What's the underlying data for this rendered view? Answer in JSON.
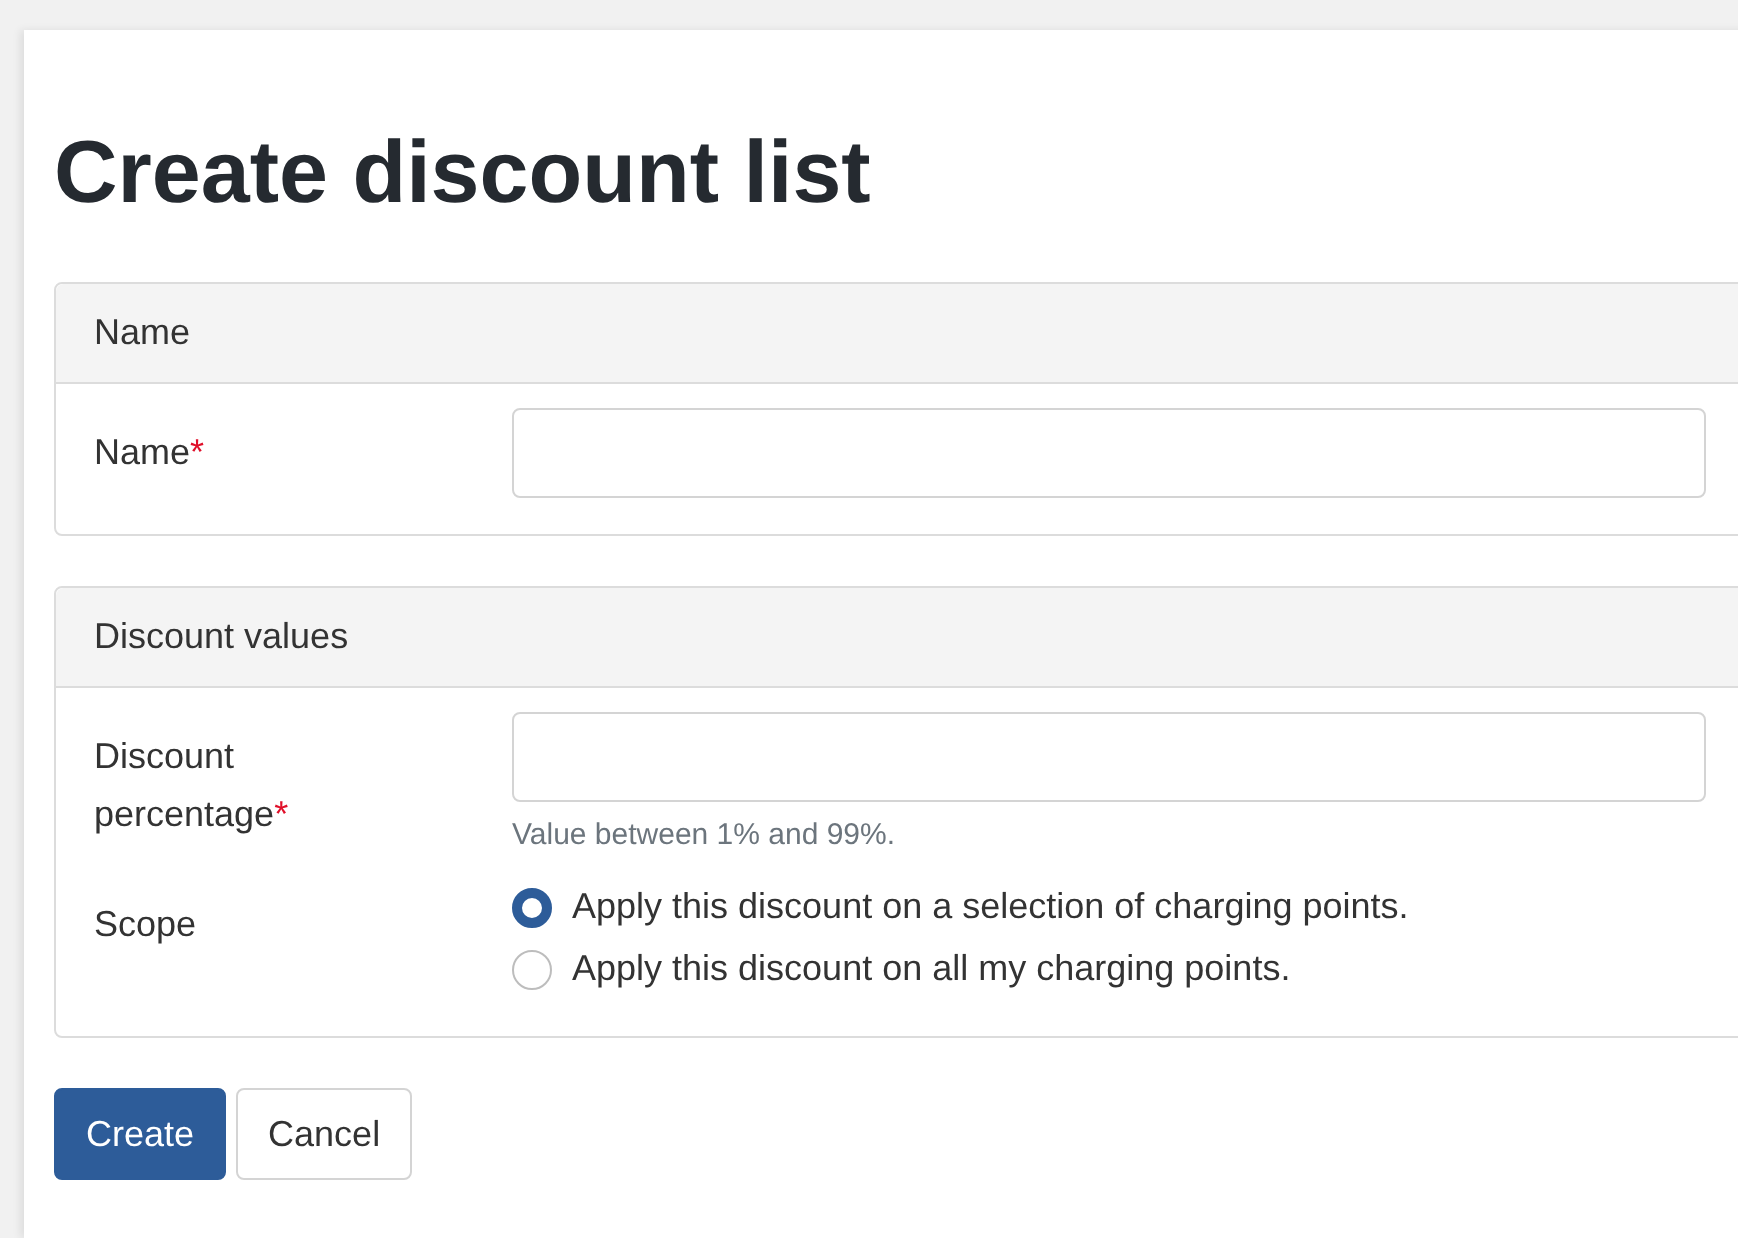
{
  "title": "Create discount list",
  "sections": [
    {
      "title": "Name",
      "fields": [
        {
          "kind": "text",
          "label": "Name",
          "required_mark": "*"
        }
      ]
    },
    {
      "title": "Discount values",
      "fields": [
        {
          "kind": "text",
          "label": "Discount percentage",
          "required_mark": "*",
          "help": "Value between 1% and 99%."
        },
        {
          "kind": "radio",
          "label": "Scope",
          "options": [
            {
              "label": "Apply this discount on a selection of charging points.",
              "selected": true
            },
            {
              "label": "Apply this discount on all my charging points.",
              "selected": false
            }
          ]
        }
      ]
    }
  ],
  "buttons": [
    {
      "label": "Create",
      "kind": "primary"
    },
    {
      "label": "Cancel",
      "kind": "secondary"
    }
  ]
}
